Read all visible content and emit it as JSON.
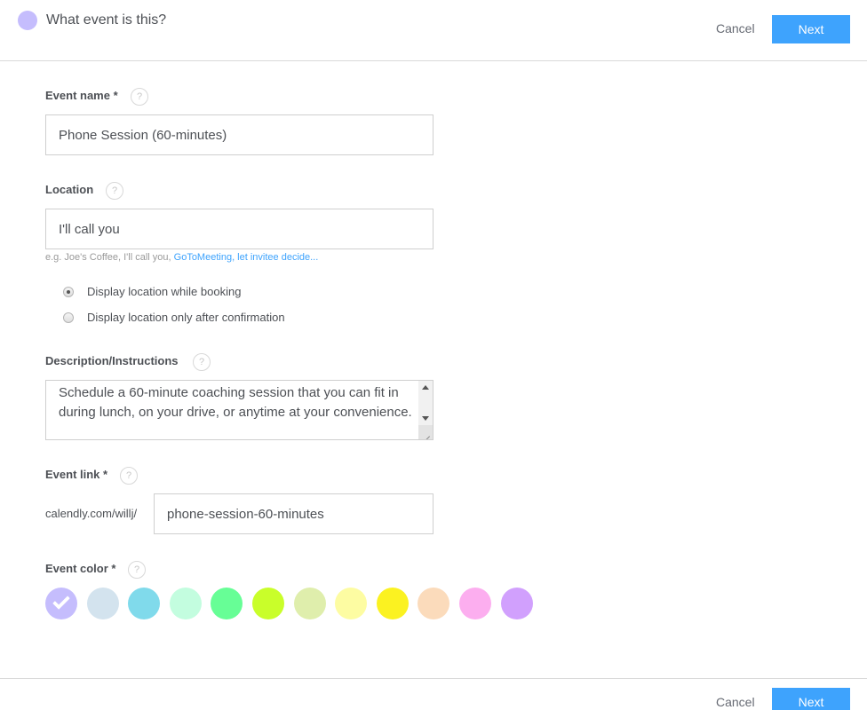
{
  "header": {
    "title": "What event is this?",
    "cancel_label": "Cancel",
    "next_label": "Next"
  },
  "form": {
    "event_name": {
      "label": "Event name *",
      "help": "?",
      "value": "Phone Session (60-minutes)"
    },
    "location": {
      "label": "Location",
      "help": "?",
      "value": "I'll call you",
      "hint_prefix": "e.g. Joe's Coffee, I'll call you, ",
      "hint_link": "GoToMeeting, let invitee decide...",
      "options": [
        {
          "label": "Display location while booking",
          "checked": true
        },
        {
          "label": "Display location only after confirmation",
          "checked": false
        }
      ]
    },
    "description": {
      "label": "Description/Instructions",
      "help": "?",
      "value": "Schedule a 60-minute coaching session that you can fit in during lunch, on your drive, or anytime at your convenience."
    },
    "event_link": {
      "label": "Event link *",
      "help": "?",
      "prefix": "calendly.com/willj/",
      "value": "phone-session-60-minutes"
    },
    "event_color": {
      "label": "Event color *",
      "help": "?",
      "selected_index": 0,
      "colors": [
        "#c5bdfd",
        "#d3e3ee",
        "#80daeb",
        "#c3fddf",
        "#67fe96",
        "#c9fe2a",
        "#dfeeac",
        "#fdfca2",
        "#fbf221",
        "#fbdbbb",
        "#fcaeef",
        "#d1a0fd"
      ]
    }
  },
  "footer": {
    "cancel_label": "Cancel",
    "next_label": "Next"
  }
}
